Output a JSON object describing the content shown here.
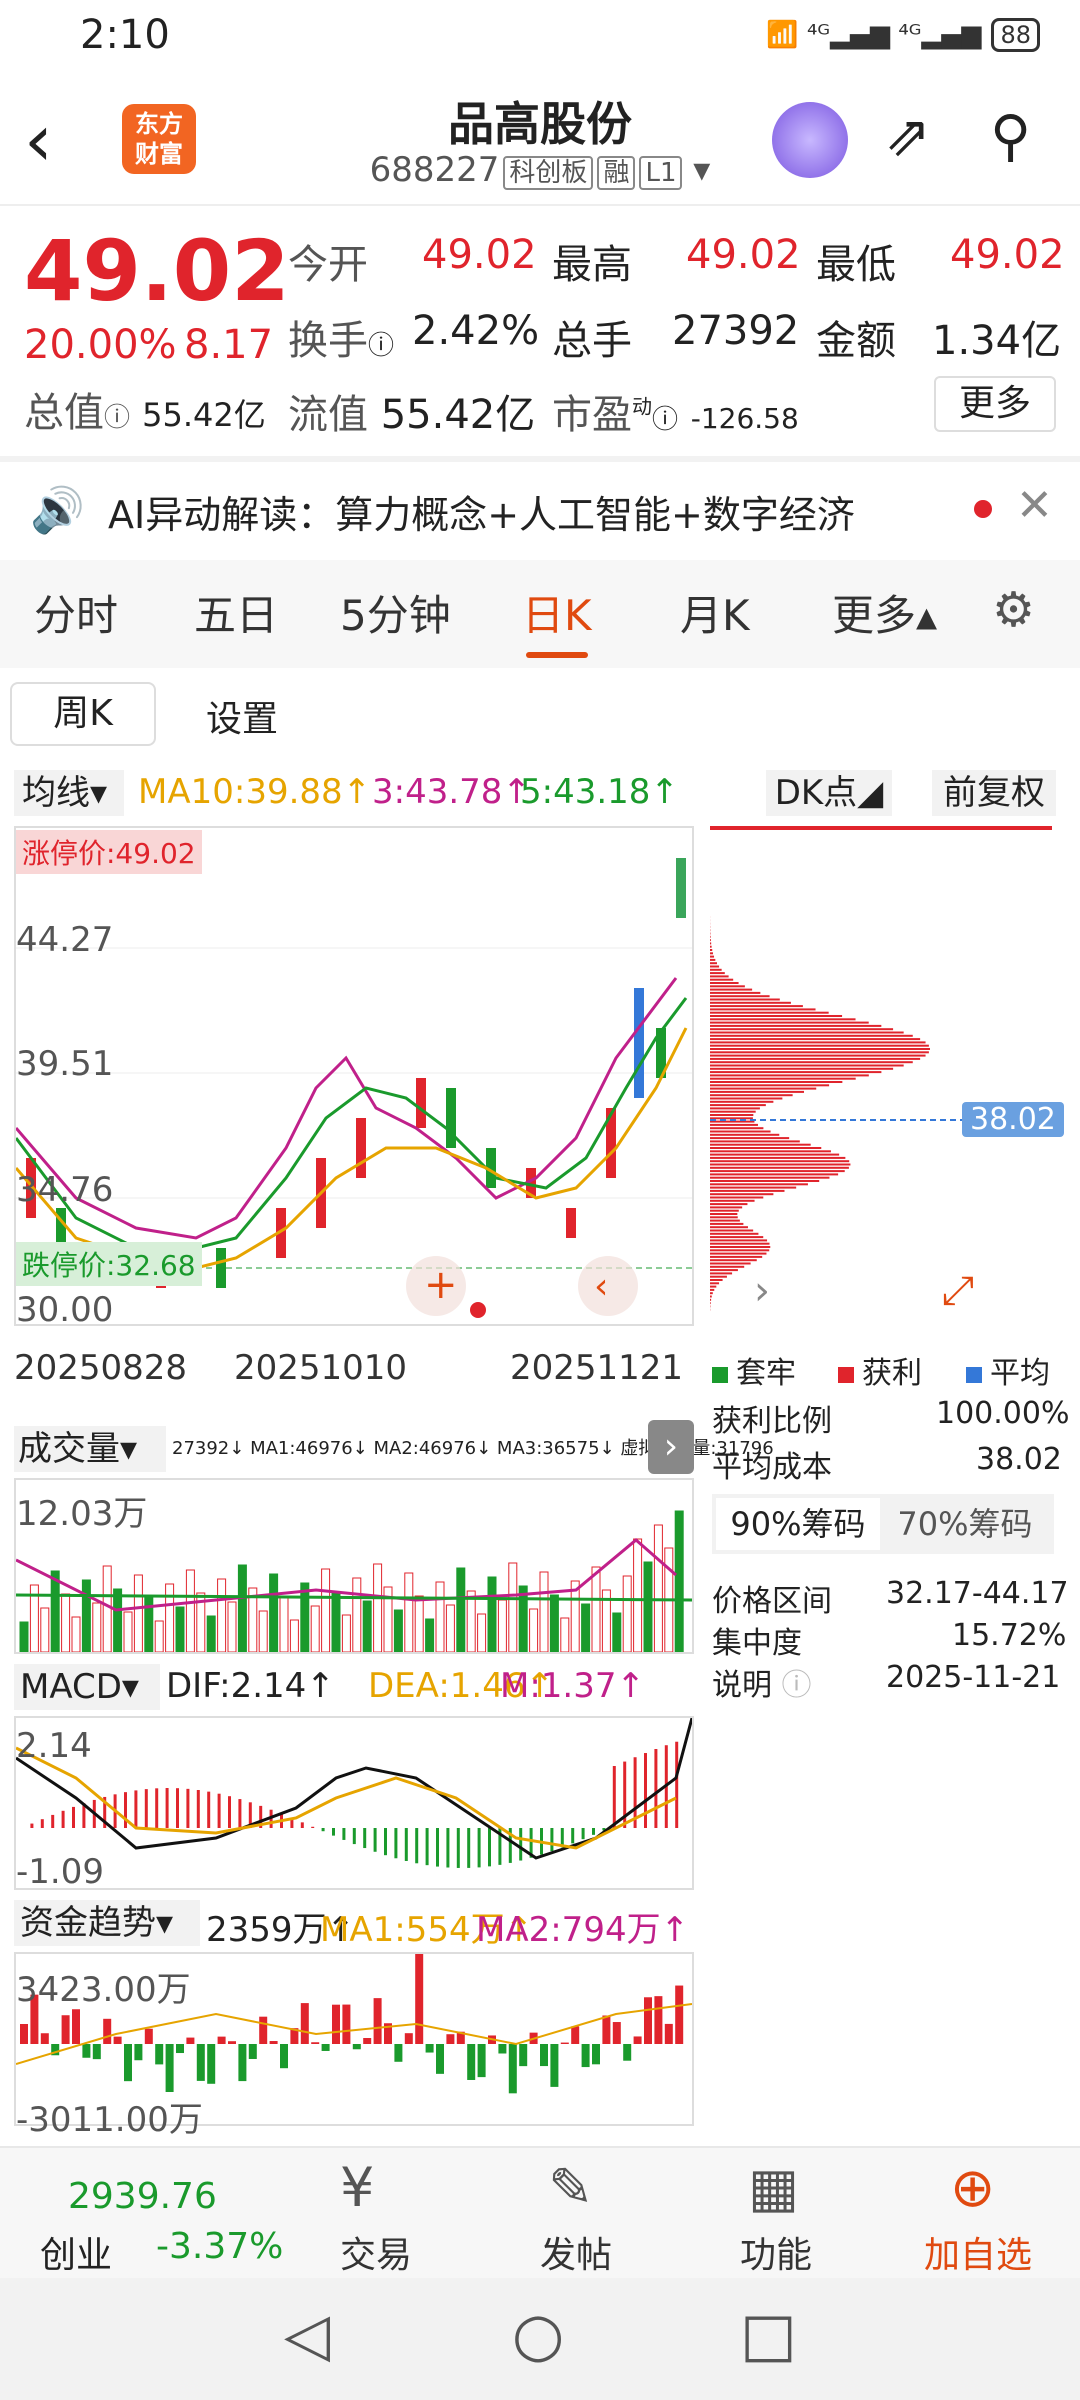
{
  "status": {
    "time": "2:10",
    "icons": "📶 ⁴ᴳ▂▄▆ ⁴ᴳ▂▄▆",
    "battery": "88"
  },
  "header": {
    "logo": "东方\n财富",
    "title": "品高股份",
    "code": "688227",
    "tags": [
      "科创板",
      "融",
      "L1"
    ]
  },
  "quote": {
    "price": "49.02",
    "pct": "20.00%",
    "chg": "8.17",
    "total_label": "总值",
    "total_value": "55.42亿",
    "open_label": "今开",
    "open": "49.02",
    "high_label": "最高",
    "high": "49.02",
    "low_label": "最低",
    "low": "49.02",
    "turn_label": "换手",
    "turn": "2.42%",
    "vol_label": "总手",
    "vol": "27392",
    "amt_label": "金额",
    "amt": "1.34亿",
    "float_label": "流值",
    "float": "55.42亿",
    "pe_label": "市盈",
    "pe_sup": "动",
    "pe": "-126.58",
    "more": "更多"
  },
  "ai": {
    "text": "AI异动解读：算力概念+人工智能+数字经济"
  },
  "tabs": [
    "分时",
    "五日",
    "5分钟",
    "日K",
    "月K",
    "更多▴"
  ],
  "subtabs": {
    "week": "周K",
    "setting": "设置"
  },
  "ma": {
    "select": "均线▾",
    "ma10": "MA10:39.88↑",
    "ma3": "3:43.78↑",
    "ma5": "5:43.18↑",
    "dk": "DK点◢",
    "fq": "前复权"
  },
  "kchart": {
    "zt_label": "涨停价:49.02",
    "dt_label": "跌停价:32.68",
    "y_labels": [
      "44.27",
      "39.51",
      "34.76",
      "30.00"
    ],
    "x_labels": [
      "20250828",
      "20251010",
      "20251121"
    ]
  },
  "chart_data": {
    "type": "candlestick",
    "y_ticks": [
      "44.27",
      "39.51",
      "34.76",
      "30.00"
    ],
    "x_ticks": [
      "20250828",
      "20251010",
      "20251121"
    ],
    "ma_values": {
      "MA10": 39.88,
      "MA3": 43.78,
      "MA5": 43.18
    },
    "limit_up": 49.02,
    "limit_down": 32.68
  },
  "chip": {
    "avg_price": "38.02",
    "legend": [
      "套牢",
      "获利",
      "平均"
    ],
    "legend_colors": [
      "#1a9a2c",
      "#e0242c",
      "#3478d8"
    ],
    "profit_label": "获利比例",
    "profit": "100.00%",
    "cost_label": "平均成本",
    "cost": "38.02",
    "tab90": "90%筹码",
    "tab70": "70%筹码",
    "range_label": "价格区间",
    "range": "32.17-44.17",
    "conc_label": "集中度",
    "conc": "15.72%",
    "note_label": "说明",
    "note": "2025-11-21"
  },
  "volume": {
    "select": "成交量▾",
    "info": "27392↓ MA1:46976↓ MA2:46976↓ MA3:36575↓ 虚拟成交量:31796",
    "max": "12.03万"
  },
  "macd": {
    "select": "MACD▾",
    "dif": "DIF:2.14↑",
    "dea": "DEA:1.46↑",
    "m": "M:1.37↑",
    "top": "2.14",
    "bottom": "-1.09"
  },
  "fund": {
    "select": "资金趋势▾",
    "val": "2359万↑",
    "ma1": "MA1:554万↑",
    "ma2": "MA2:794万↑",
    "top": "3423.00万",
    "bottom": "-3011.00万"
  },
  "bottom_nav": {
    "index_value": "2939.76",
    "index_name": "创业",
    "index_pct": "-3.37%",
    "trade": "交易",
    "post": "发帖",
    "func": "功能",
    "add": "加自选"
  }
}
